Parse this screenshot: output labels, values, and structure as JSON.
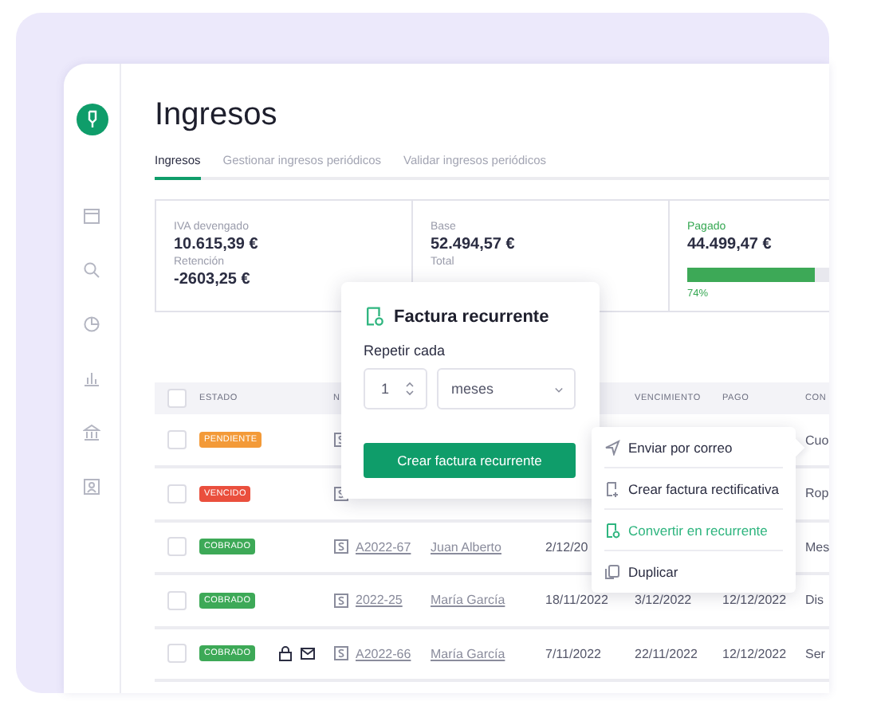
{
  "page": {
    "title": "Ingresos"
  },
  "tabs": [
    {
      "label": "Ingresos",
      "selected": true
    },
    {
      "label": "Gestionar ingresos periódicos",
      "selected": false
    },
    {
      "label": "Validar ingresos periódicos",
      "selected": false
    }
  ],
  "stats": [
    {
      "kind": "plain",
      "label": "IVA devengado",
      "value": "10.615,39 €",
      "sub_label": "Retención",
      "sub_value": "-2603,25 €"
    },
    {
      "kind": "plain",
      "label": "Base",
      "value": "52.494,57 €",
      "sub_label": "Total"
    },
    {
      "kind": "progress",
      "label": "Pagado",
      "value": "44.499,47 €",
      "level": 0.74,
      "reading": "74%"
    }
  ],
  "table": {
    "header": {
      "checked": false,
      "status": "ESTADO",
      "number": "N",
      "due": "VENCIMIENTO",
      "paid": "PAGO",
      "concept": "CON"
    },
    "rows": [
      {
        "checked": false,
        "status": {
          "label": "PENDIENTE",
          "kind": "pending"
        },
        "locked": false,
        "emailed": false,
        "concept": "Cuo"
      },
      {
        "checked": false,
        "status": {
          "label": "VENCIDO",
          "kind": "overdue"
        },
        "locked": false,
        "emailed": false,
        "concept": "Rop"
      },
      {
        "checked": false,
        "status": {
          "label": "COBRADO",
          "kind": "paid"
        },
        "locked": false,
        "emailed": false,
        "number": "A2022-67",
        "client": "Juan Alberto",
        "issued": "2/12/20",
        "concept": "Mes"
      },
      {
        "checked": false,
        "status": {
          "label": "COBRADO",
          "kind": "paid"
        },
        "locked": false,
        "emailed": false,
        "number": "2022-25",
        "client": "María García",
        "issued": "18/11/2022",
        "due": "3/12/2022",
        "paid": "12/12/2022",
        "concept": "Dis"
      },
      {
        "checked": false,
        "status": {
          "label": "COBRADO",
          "kind": "paid"
        },
        "locked": true,
        "emailed": true,
        "number": "A2022-66",
        "client": "María García",
        "issued": "7/11/2022",
        "due": "22/11/2022",
        "paid": "12/12/2022",
        "concept": "Ser"
      }
    ]
  },
  "popover": {
    "title": "Factura recurrente",
    "label": "Repetir cada",
    "quantity": "1",
    "unit": "meses",
    "button": "Crear factura recurrente"
  },
  "menu": [
    {
      "label": "Enviar por correo",
      "kind": "send",
      "selected": false
    },
    {
      "label": "Crear factura rectificativa",
      "kind": "rectify",
      "selected": false
    },
    {
      "label": "Convertir en recurrente",
      "kind": "recurring",
      "selected": true
    },
    {
      "label": "Duplicar",
      "kind": "duplicate",
      "selected": false
    }
  ]
}
